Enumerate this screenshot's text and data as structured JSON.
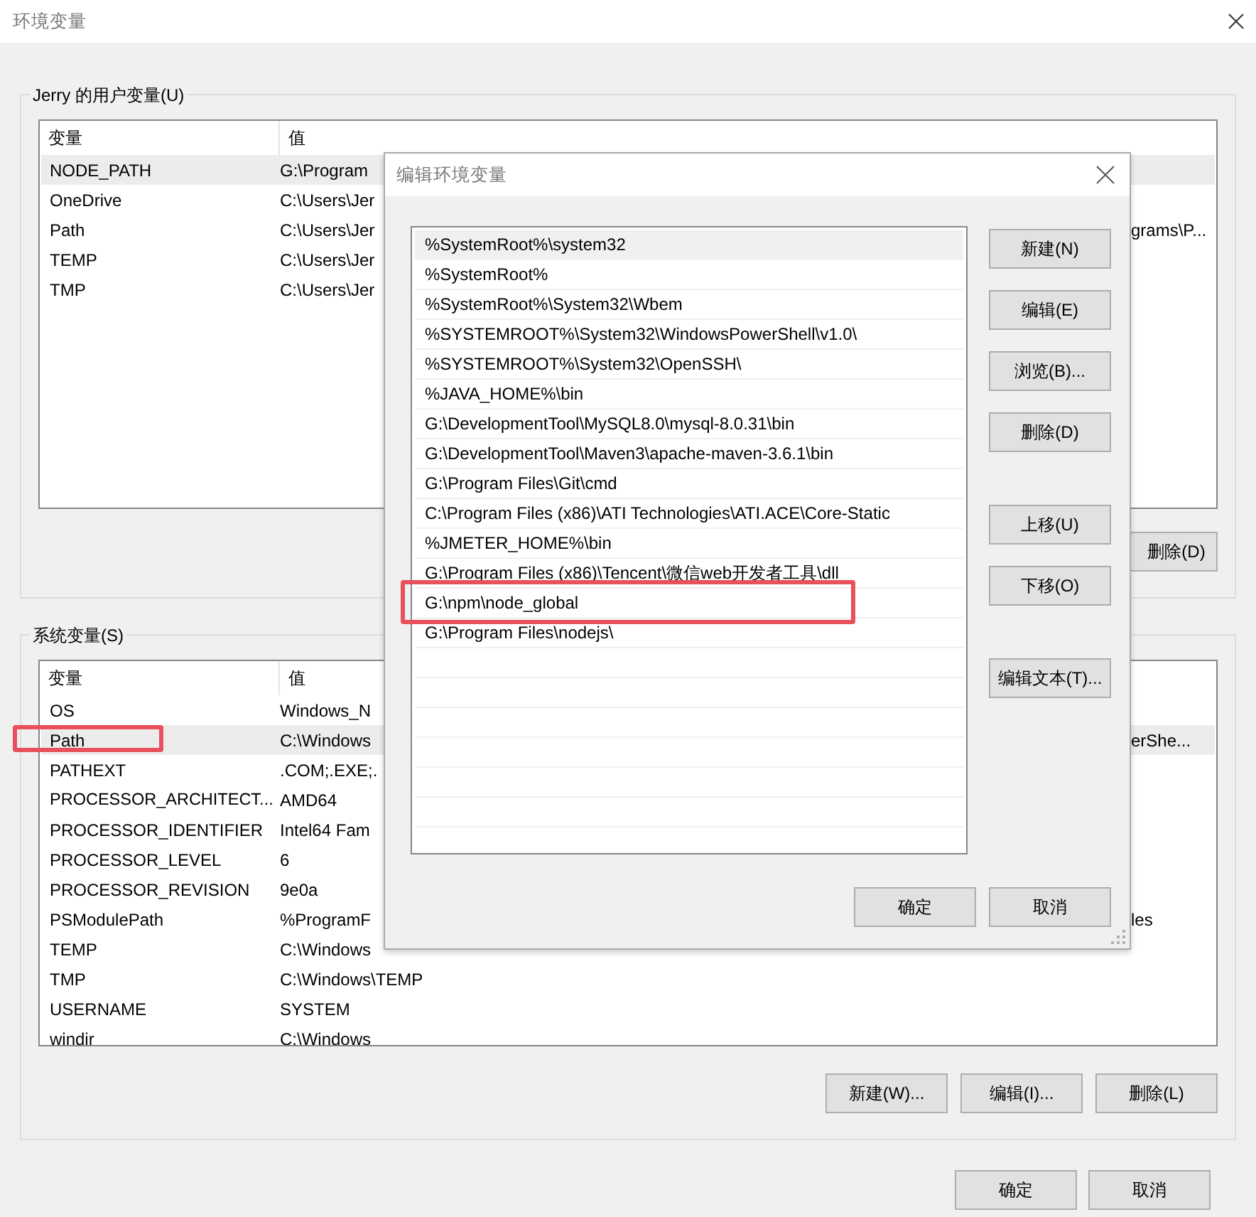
{
  "window": {
    "title": "环境变量"
  },
  "user_vars": {
    "title": "Jerry 的用户变量(U)",
    "columns": [
      "变量",
      "值"
    ],
    "rows": [
      {
        "name": "NODE_PATH",
        "value": "G:\\Program",
        "selected": true
      },
      {
        "name": "OneDrive",
        "value": "C:\\Users\\Jer",
        "selected": false
      },
      {
        "name": "Path",
        "value": "C:\\Users\\Jer",
        "tail": "grams\\P...",
        "selected": false
      },
      {
        "name": "TEMP",
        "value": "C:\\Users\\Jer",
        "selected": false
      },
      {
        "name": "TMP",
        "value": "C:\\Users\\Jer",
        "selected": false
      }
    ],
    "buttons": [
      "删除(D)"
    ]
  },
  "system_vars": {
    "title": "系统变量(S)",
    "columns": [
      "变量",
      "值"
    ],
    "rows": [
      {
        "name": "OS",
        "value": "Windows_N",
        "selected": false,
        "highlighted": false
      },
      {
        "name": "Path",
        "value": "C:\\Windows",
        "tail": "erShe...",
        "selected": true,
        "highlighted": true
      },
      {
        "name": "PATHEXT",
        "value": ".COM;.EXE;.",
        "selected": false,
        "highlighted": false
      },
      {
        "name": "PROCESSOR_ARCHITECT...",
        "value": "AMD64",
        "selected": false,
        "highlighted": false
      },
      {
        "name": "PROCESSOR_IDENTIFIER",
        "value": "Intel64 Fam",
        "selected": false,
        "highlighted": false
      },
      {
        "name": "PROCESSOR_LEVEL",
        "value": "6",
        "selected": false,
        "highlighted": false
      },
      {
        "name": "PROCESSOR_REVISION",
        "value": "9e0a",
        "selected": false,
        "highlighted": false
      },
      {
        "name": "PSModulePath",
        "value": "%ProgramF",
        "tail": "les",
        "selected": false,
        "highlighted": false
      },
      {
        "name": "TEMP",
        "value": "C:\\Windows",
        "selected": false,
        "highlighted": false
      },
      {
        "name": "TMP",
        "value": "C:\\Windows\\TEMP",
        "selected": false,
        "highlighted": false
      },
      {
        "name": "USERNAME",
        "value": "SYSTEM",
        "selected": false,
        "highlighted": false
      },
      {
        "name": "windir",
        "value": "C:\\Windows",
        "selected": false,
        "highlighted": false
      }
    ],
    "buttons": [
      "新建(W)...",
      "编辑(I)...",
      "删除(L)"
    ]
  },
  "buttons": [
    "确定",
    "取消"
  ],
  "edit_dialog": {
    "title": "编辑环境变量",
    "items": [
      {
        "text": "%SystemRoot%\\system32",
        "selected": true,
        "highlighted": false
      },
      {
        "text": "%SystemRoot%",
        "selected": false,
        "highlighted": false
      },
      {
        "text": "%SystemRoot%\\System32\\Wbem",
        "selected": false,
        "highlighted": false
      },
      {
        "text": "%SYSTEMROOT%\\System32\\WindowsPowerShell\\v1.0\\",
        "selected": false,
        "highlighted": false
      },
      {
        "text": "%SYSTEMROOT%\\System32\\OpenSSH\\",
        "selected": false,
        "highlighted": false
      },
      {
        "text": "%JAVA_HOME%\\bin",
        "selected": false,
        "highlighted": false
      },
      {
        "text": "G:\\DevelopmentTool\\MySQL8.0\\mysql-8.0.31\\bin",
        "selected": false,
        "highlighted": false
      },
      {
        "text": "G:\\DevelopmentTool\\Maven3\\apache-maven-3.6.1\\bin",
        "selected": false,
        "highlighted": false
      },
      {
        "text": "G:\\Program Files\\Git\\cmd",
        "selected": false,
        "highlighted": false
      },
      {
        "text": "C:\\Program Files (x86)\\ATI Technologies\\ATI.ACE\\Core-Static",
        "selected": false,
        "highlighted": false
      },
      {
        "text": "%JMETER_HOME%\\bin",
        "selected": false,
        "highlighted": false
      },
      {
        "text": "G:\\Program Files (x86)\\Tencent\\微信web开发者工具\\dll",
        "selected": false,
        "highlighted": false
      },
      {
        "text": "G:\\npm\\node_global",
        "selected": false,
        "highlighted": true
      },
      {
        "text": "G:\\Program Files\\nodejs\\",
        "selected": false,
        "highlighted": false
      }
    ],
    "side_buttons": [
      [
        "新建(N)",
        "编辑(E)",
        "浏览(B)...",
        "删除(D)"
      ],
      [
        "上移(U)",
        "下移(O)"
      ],
      [
        "编辑文本(T)..."
      ]
    ],
    "buttons": [
      "确定",
      "取消"
    ]
  }
}
